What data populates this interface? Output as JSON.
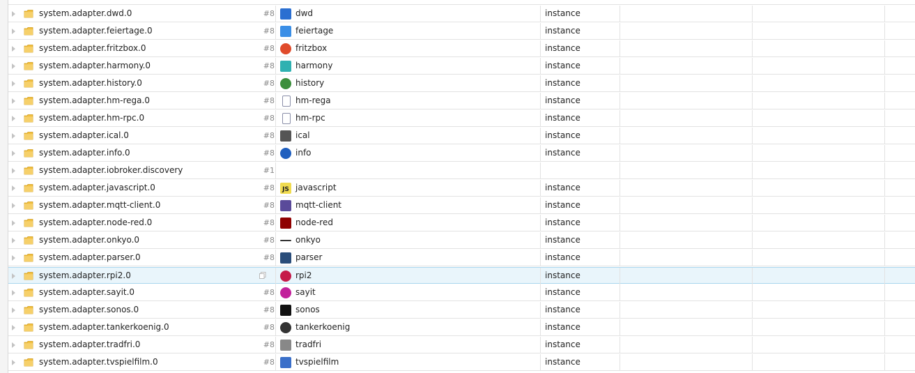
{
  "tree": {
    "rows": [
      {
        "id": "system.adapter.dwd.0",
        "count": "#8",
        "title": "dwd",
        "role": "instance",
        "icon": "dwd-icon",
        "color": "#2b6fd1"
      },
      {
        "id": "system.adapter.feiertage.0",
        "count": "#8",
        "title": "feiertage",
        "role": "instance",
        "icon": "calendar-icon",
        "color": "#3a8ee6"
      },
      {
        "id": "system.adapter.fritzbox.0",
        "count": "#8",
        "title": "fritzbox",
        "role": "instance",
        "icon": "fritzbox-icon",
        "color": "#e04b2b"
      },
      {
        "id": "system.adapter.harmony.0",
        "count": "#8",
        "title": "harmony",
        "role": "instance",
        "icon": "harmony-icon",
        "color": "#2fb1b1"
      },
      {
        "id": "system.adapter.history.0",
        "count": "#8",
        "title": "history",
        "role": "instance",
        "icon": "clock-icon",
        "color": "#3b8e3b"
      },
      {
        "id": "system.adapter.hm-rega.0",
        "count": "#8",
        "title": "hm-rega",
        "role": "instance",
        "icon": "hm-rega-icon",
        "color": "#8a8ea8"
      },
      {
        "id": "system.adapter.hm-rpc.0",
        "count": "#8",
        "title": "hm-rpc",
        "role": "instance",
        "icon": "hm-rpc-icon",
        "color": "#8a8ea8"
      },
      {
        "id": "system.adapter.ical.0",
        "count": "#8",
        "title": "ical",
        "role": "instance",
        "icon": "ical-icon",
        "color": "#555555"
      },
      {
        "id": "system.adapter.info.0",
        "count": "#8",
        "title": "info",
        "role": "instance",
        "icon": "info-icon",
        "color": "#1f5fbf"
      },
      {
        "id": "system.adapter.iobroker.discovery",
        "count": "#1",
        "title": "",
        "role": "",
        "icon": "",
        "color": ""
      },
      {
        "id": "system.adapter.javascript.0",
        "count": "#8",
        "title": "javascript",
        "role": "instance",
        "icon": "js-icon",
        "color": "#f0db4f"
      },
      {
        "id": "system.adapter.mqtt-client.0",
        "count": "#8",
        "title": "mqtt-client",
        "role": "instance",
        "icon": "mqtt-icon",
        "color": "#5a4a9a"
      },
      {
        "id": "system.adapter.node-red.0",
        "count": "#8",
        "title": "node-red",
        "role": "instance",
        "icon": "node-red-icon",
        "color": "#8f0000"
      },
      {
        "id": "system.adapter.onkyo.0",
        "count": "#8",
        "title": "onkyo",
        "role": "instance",
        "icon": "onkyo-icon",
        "color": "#333333"
      },
      {
        "id": "system.adapter.parser.0",
        "count": "#8",
        "title": "parser",
        "role": "instance",
        "icon": "parser-icon",
        "color": "#2a4d7a"
      },
      {
        "id": "system.adapter.rpi2.0",
        "count": "",
        "title": "rpi2",
        "role": "instance",
        "icon": "raspberry-icon",
        "color": "#c51a4a",
        "selected": true
      },
      {
        "id": "system.adapter.sayit.0",
        "count": "#8",
        "title": "sayit",
        "role": "instance",
        "icon": "sayit-icon",
        "color": "#c2219b"
      },
      {
        "id": "system.adapter.sonos.0",
        "count": "#8",
        "title": "sonos",
        "role": "instance",
        "icon": "sonos-icon",
        "color": "#111111"
      },
      {
        "id": "system.adapter.tankerkoenig.0",
        "count": "#8",
        "title": "tankerkoenig",
        "role": "instance",
        "icon": "fuel-icon",
        "color": "#333333"
      },
      {
        "id": "system.adapter.tradfri.0",
        "count": "#8",
        "title": "tradfri",
        "role": "instance",
        "icon": "tradfri-icon",
        "color": "#888888"
      },
      {
        "id": "system.adapter.tvspielfilm.0",
        "count": "#8",
        "title": "tvspielfilm",
        "role": "instance",
        "icon": "tv-icon",
        "color": "#3a6fc9"
      }
    ]
  }
}
